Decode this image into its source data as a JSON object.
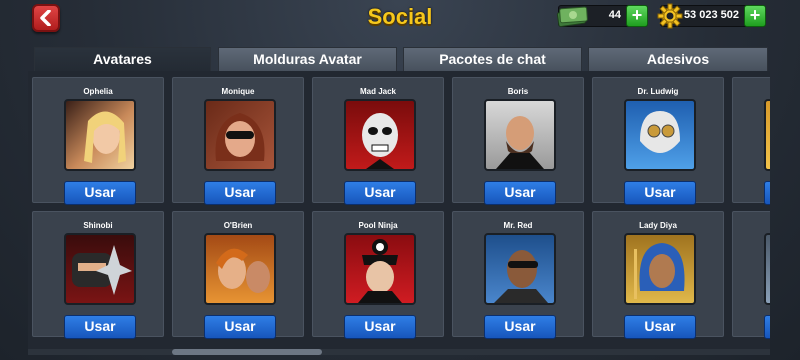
{
  "header": {
    "title": "Social",
    "back_icon": "chevron-left-icon",
    "cash": {
      "value": "44",
      "icon": "cash-icon"
    },
    "coins": {
      "value": "53 023 502",
      "icon": "coin-gear-icon"
    },
    "add_label": "+"
  },
  "tabs": [
    {
      "label": "Avatares",
      "active": true
    },
    {
      "label": "Molduras Avatar",
      "active": false
    },
    {
      "label": "Pacotes de chat",
      "active": false
    },
    {
      "label": "Adesivos",
      "active": false
    }
  ],
  "avatars": [
    {
      "name": "Ophelia",
      "button": "Usar",
      "color": "#c98a5a"
    },
    {
      "name": "Monique",
      "button": "Usar",
      "color": "#9a3a2a"
    },
    {
      "name": "Mad Jack",
      "button": "Usar",
      "color": "#b01515"
    },
    {
      "name": "Boris",
      "button": "Usar",
      "color": "#c7c7c7"
    },
    {
      "name": "Dr. Ludwig",
      "button": "Usar",
      "color": "#2f7fd0"
    },
    {
      "name": "Shinobi",
      "button": "Usar",
      "color": "#8a1a1a"
    },
    {
      "name": "O'Brien",
      "button": "Usar",
      "color": "#cf7a22"
    },
    {
      "name": "Pool Ninja",
      "button": "Usar",
      "color": "#b0141a"
    },
    {
      "name": "Mr. Red",
      "button": "Usar",
      "color": "#3a6fb0"
    },
    {
      "name": "Lady Diya",
      "button": "Usar",
      "color": "#c38e2a"
    }
  ],
  "colors": {
    "title": "#f6c81c",
    "use_button": "#1f6ad6",
    "add_button": "#22a822",
    "back_button": "#c82a2a"
  }
}
